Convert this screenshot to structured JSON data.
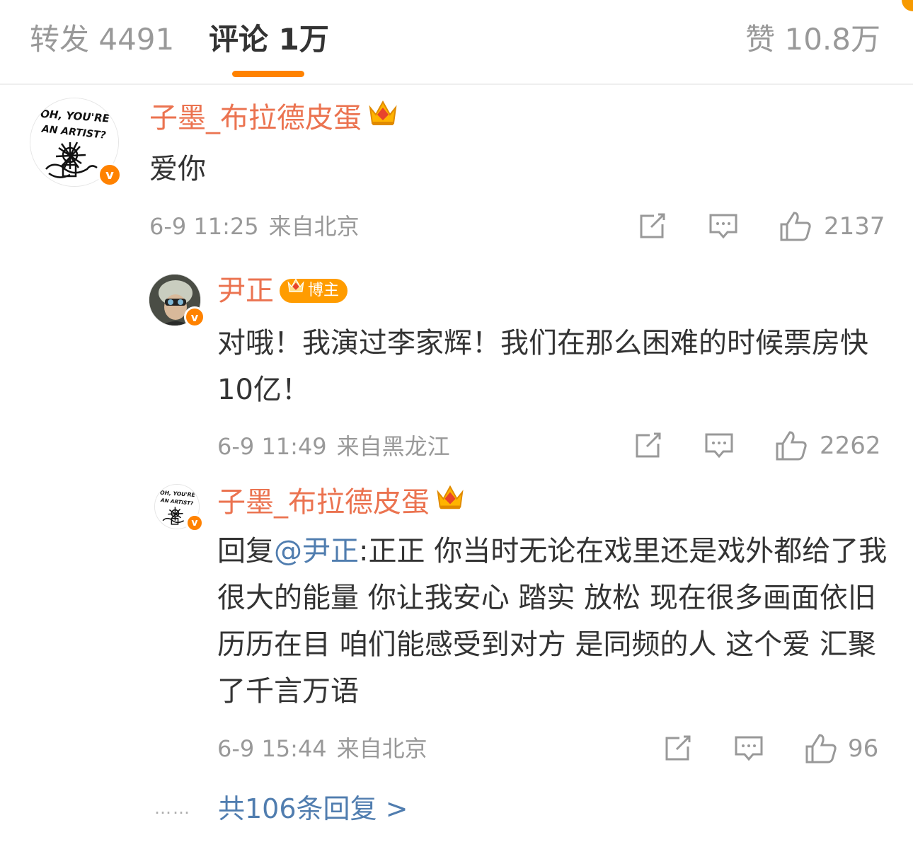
{
  "tabs": {
    "repost": "转发 4491",
    "comment": "评论 1万",
    "like": "赞 10.8万"
  },
  "comments": [
    {
      "user": "子墨_布拉德皮蛋",
      "avatar_text_1": "OH, YOU'RE",
      "avatar_text_2": "AN ARTIST?",
      "text": "爱你",
      "time": "6-9 11:25",
      "location": "来自北京",
      "likes": "2137"
    },
    {
      "user": "尹正",
      "badge": "博主",
      "text": "对哦！我演过李家辉！我们在那么困难的时候票房快10亿！",
      "time": "6-9 11:49",
      "location": "来自黑龙江",
      "likes": "2262"
    },
    {
      "user": "子墨_布拉德皮蛋",
      "reply_prefix": "回复",
      "mention": "@尹正",
      "text": ":正正 你当时无论在戏里还是戏外都给了我很大的能量 你让我安心 踏实 放松 现在很多画面依旧历历在目 咱们能感受到对方 是同频的人 这个爱 汇聚了千言万语",
      "time": "6-9 15:44",
      "location": "来自北京",
      "likes": "96"
    }
  ],
  "more_replies": "共106条回复 >",
  "dots": "……",
  "colors": {
    "accent": "#ff8200",
    "username": "#eb7350",
    "link": "#507daf",
    "meta": "#999999"
  },
  "icons": [
    "crown-icon",
    "verified-icon",
    "repost-icon",
    "comment-icon",
    "like-icon"
  ]
}
